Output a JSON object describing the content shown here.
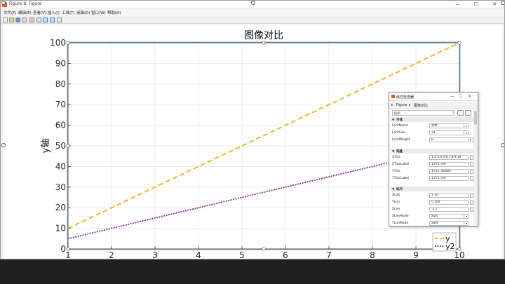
{
  "window": {
    "title": "Figure 8: Figure",
    "controls": [
      "—",
      "☐",
      "✕"
    ]
  },
  "menubar": {
    "items": [
      "文件(F)",
      "编辑(E)",
      "查看(V)",
      "插入(I)",
      "工具(T)",
      "桌面(D)",
      "窗口(W)",
      "帮助(H)"
    ]
  },
  "toolbar": {
    "icons": [
      "new-file-icon",
      "open-icon",
      "save-icon",
      "print-icon",
      "link-icon",
      "toggle-plot-tools-icon",
      "show-plot-tools-icon",
      "edit-plot-icon",
      "hide-plot-tools-icon"
    ]
  },
  "chart_data": {
    "type": "line",
    "title": "图像对比",
    "xlabel": "",
    "ylabel": "y轴",
    "xlim": [
      1,
      10
    ],
    "ylim": [
      0,
      100
    ],
    "xticks": [
      1,
      2,
      3,
      4,
      5,
      6,
      7,
      8,
      9,
      10
    ],
    "yticks": [
      0,
      10,
      20,
      30,
      40,
      50,
      60,
      70,
      80,
      90,
      100
    ],
    "grid": true,
    "legend_position": "bottom-right",
    "x": [
      1,
      2,
      3,
      4,
      5,
      6,
      7,
      8,
      9,
      10
    ],
    "series": [
      {
        "name": "y",
        "values": [
          10,
          20,
          30,
          40,
          50,
          60,
          70,
          80,
          90,
          100
        ],
        "color": "#edb120",
        "style": "dashed"
      },
      {
        "name": "y2",
        "values": [
          5,
          10,
          15,
          20,
          25,
          30,
          35,
          40,
          45,
          50
        ],
        "color": "#7e2f8e",
        "style": "dotted"
      }
    ]
  },
  "inspector": {
    "title": "属性检查器",
    "controls": [
      "—",
      "☐",
      "✕"
    ],
    "breadcrumb": [
      "Figure",
      "图像对比"
    ],
    "search_placeholder": "搜索",
    "sections": [
      {
        "name": "字体",
        "rows": [
          {
            "key": "FontName",
            "value": "黑体",
            "dropdown": true
          },
          {
            "key": "FontSize",
            "value": "24",
            "dropdown": true
          },
          {
            "key": "FontWeight",
            "value": "B",
            "dropdown": false
          }
        ]
      },
      {
        "name": "刻度",
        "rows": [
          {
            "key": "XTick",
            "value": "1,2,3,4,5,6,7,8,9,10",
            "dropdown": false
          },
          {
            "key": "XTickLabel",
            "value": "10×1 cell",
            "dropdown": false
          },
          {
            "key": "YTick",
            "value": "1×11 double",
            "dropdown": false
          },
          {
            "key": "YTickLabel",
            "value": "11×1 cell",
            "dropdown": false
          }
        ]
      },
      {
        "name": "标尺",
        "rows": [
          {
            "key": "XLim",
            "value": "1 10",
            "dropdown": false
          },
          {
            "key": "YLim",
            "value": "0 100",
            "dropdown": false
          },
          {
            "key": "ZLim",
            "value": "-1 1",
            "dropdown": false
          },
          {
            "key": "XLimMode",
            "value": "auto",
            "dropdown": true
          },
          {
            "key": "YLimMode",
            "value": "auto",
            "dropdown": true
          }
        ]
      }
    ]
  }
}
